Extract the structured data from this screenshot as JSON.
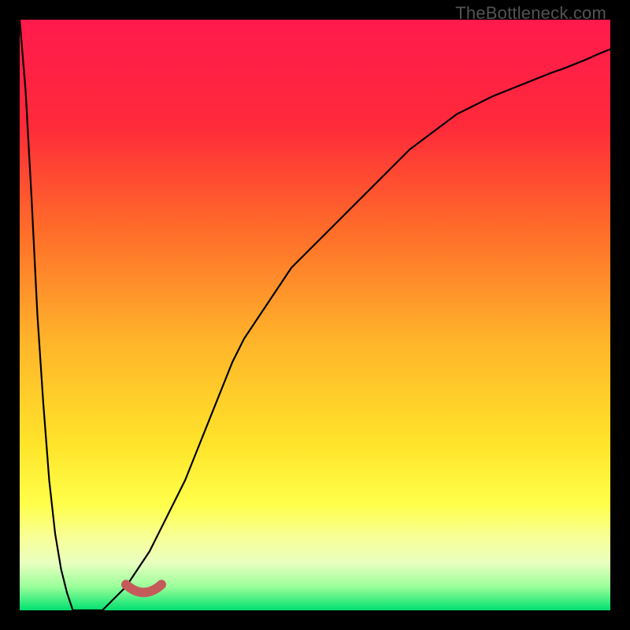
{
  "watermark": "TheBottleneck.com",
  "chart_data": {
    "type": "line",
    "title": "",
    "xlabel": "",
    "ylabel": "",
    "xlim": [
      0,
      100
    ],
    "ylim": [
      0,
      100
    ],
    "x": [
      0,
      1,
      2,
      3,
      4,
      5,
      6,
      7,
      8,
      9,
      10,
      12,
      14,
      16,
      18,
      20,
      22,
      24,
      26,
      28,
      30,
      32,
      34,
      36,
      38,
      40,
      42,
      44,
      46,
      48,
      50,
      52,
      54,
      56,
      58,
      60,
      62,
      64,
      66,
      68,
      70,
      72,
      74,
      76,
      78,
      80,
      82,
      84,
      86,
      88,
      90,
      92,
      94,
      96,
      98,
      100
    ],
    "series": [
      {
        "name": "bottleneck-curve",
        "y": [
          0,
          12,
          30,
          50,
          65,
          78,
          87,
          93,
          97,
          100,
          100,
          100,
          100,
          98,
          96,
          93,
          90,
          86,
          82,
          78,
          73,
          68,
          63,
          58,
          54,
          51,
          48,
          45,
          42,
          40,
          38,
          36,
          34,
          32,
          30,
          28,
          26,
          24,
          22,
          20.5,
          19,
          17.5,
          16,
          15,
          14,
          13,
          12.2,
          11.4,
          10.6,
          9.8,
          9,
          8.3,
          7.5,
          6.7,
          5.8,
          5
        ]
      }
    ],
    "minimum_marker": {
      "x_range": [
        18,
        24
      ],
      "y": 2.5
    },
    "gradient_stops": [
      {
        "offset": 0.0,
        "color": "#ff1a4d"
      },
      {
        "offset": 0.18,
        "color": "#ff2a3a"
      },
      {
        "offset": 0.35,
        "color": "#ff6a2a"
      },
      {
        "offset": 0.55,
        "color": "#ffb62a"
      },
      {
        "offset": 0.72,
        "color": "#ffe42a"
      },
      {
        "offset": 0.82,
        "color": "#ffff4a"
      },
      {
        "offset": 0.88,
        "color": "#f7ff9a"
      },
      {
        "offset": 0.92,
        "color": "#e8ffc0"
      },
      {
        "offset": 0.96,
        "color": "#9aff9a"
      },
      {
        "offset": 1.0,
        "color": "#00e070"
      }
    ],
    "marker_color": "#c55a5a"
  }
}
